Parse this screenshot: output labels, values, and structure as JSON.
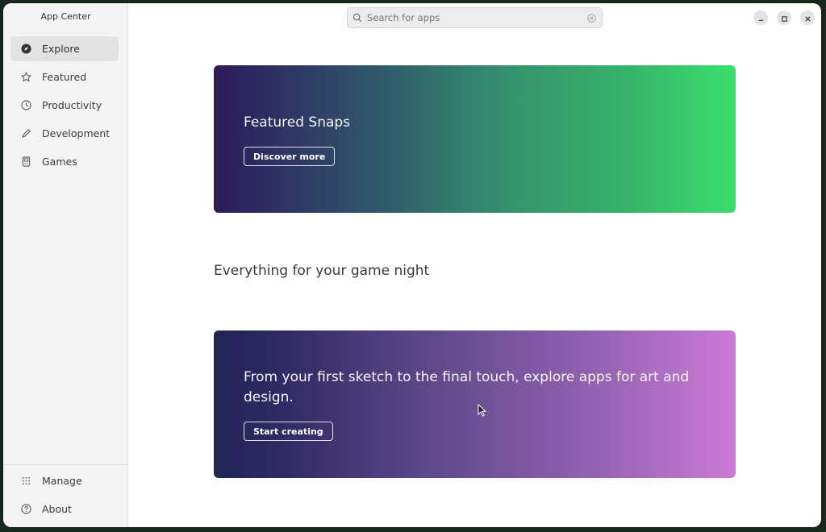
{
  "app": {
    "title": "App Center"
  },
  "sidebar": {
    "items": [
      {
        "label": "Explore",
        "icon": "compass-icon",
        "active": true
      },
      {
        "label": "Featured",
        "icon": "star-icon"
      },
      {
        "label": "Productivity",
        "icon": "clock-icon"
      },
      {
        "label": "Development",
        "icon": "pencil-icon"
      },
      {
        "label": "Games",
        "icon": "gamepad-icon"
      }
    ],
    "bottom": [
      {
        "label": "Manage",
        "icon": "grid-icon"
      },
      {
        "label": "About",
        "icon": "help-icon"
      }
    ]
  },
  "search": {
    "placeholder": "Search for apps",
    "value": ""
  },
  "banners": [
    {
      "title": "Featured Snaps",
      "button": "Discover more",
      "colors": [
        "#2b1b57",
        "#3bdf6e"
      ]
    },
    {
      "title": "From your first sketch to the final touch, explore apps for art and design.",
      "button": "Start creating",
      "colors": [
        "#1f2356",
        "#cb7ad6"
      ]
    }
  ],
  "sections": {
    "game_night": "Everything for your game night"
  }
}
